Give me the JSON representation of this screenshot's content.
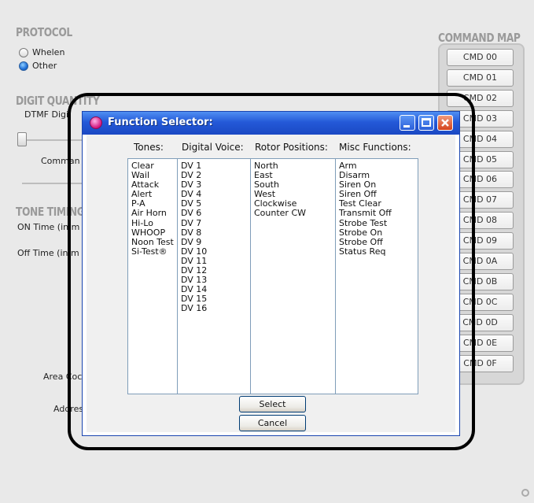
{
  "background": {
    "protocol_title": "PROTOCOL",
    "protocol_options": [
      {
        "label": "Whelen",
        "selected": false
      },
      {
        "label": "Other",
        "selected": true
      }
    ],
    "digit_quantity_title": "DIGIT QUANTITY",
    "dtmf_label": "DTMF Digi",
    "command_label": "Comman",
    "tone_timing_title": "TONE TIMING",
    "on_time_label": "ON Time (in m",
    "off_time_label": "Off Time (in m",
    "area_code_label": "Area Coc",
    "address_label": "Addres",
    "command_map_title": "COMMAND MAP",
    "command_map_items": [
      "CMD 00",
      "CMD 01",
      "CMD 02",
      "CMD 03",
      "CMD 04",
      "CMD 05",
      "CMD 06",
      "CMD 07",
      "CMD 08",
      "CMD 09",
      "CMD 0A",
      "CMD 0B",
      "CMD 0C",
      "CMD 0D",
      "CMD 0E",
      "CMD 0F"
    ]
  },
  "dialog": {
    "title": "Function Selector:",
    "columns": [
      {
        "header": "Tones:",
        "items": [
          "Clear",
          "Wail",
          "Attack",
          "Alert",
          "P-A",
          "Air Horn",
          "Hi-Lo",
          "WHOOP",
          "Noon Test",
          "Si-Test®"
        ]
      },
      {
        "header": "Digital Voice:",
        "items": [
          "DV 1",
          "DV 2",
          "DV 3",
          "DV 4",
          "DV 5",
          "DV 6",
          "DV 7",
          "DV 8",
          "DV 9",
          "DV 10",
          "DV 11",
          "DV 12",
          "DV 13",
          "DV 14",
          "DV 15",
          "DV 16"
        ]
      },
      {
        "header": "Rotor Positions:",
        "items": [
          "North",
          "East",
          "South",
          "West",
          "Clockwise",
          "Counter CW"
        ]
      },
      {
        "header": "Misc Functions:",
        "items": [
          "Arm",
          "Disarm",
          "Siren On",
          "Siren Off",
          "Test Clear",
          "Transmit Off",
          "Strobe Test",
          "Strobe On",
          "Strobe Off",
          "Status Req"
        ]
      }
    ],
    "select_label": "Select",
    "cancel_label": "Cancel"
  },
  "colors": {
    "titlebar": "#2459d8",
    "header_gray": "#9a9a9a",
    "radio_selected": "#1f6fd8"
  }
}
